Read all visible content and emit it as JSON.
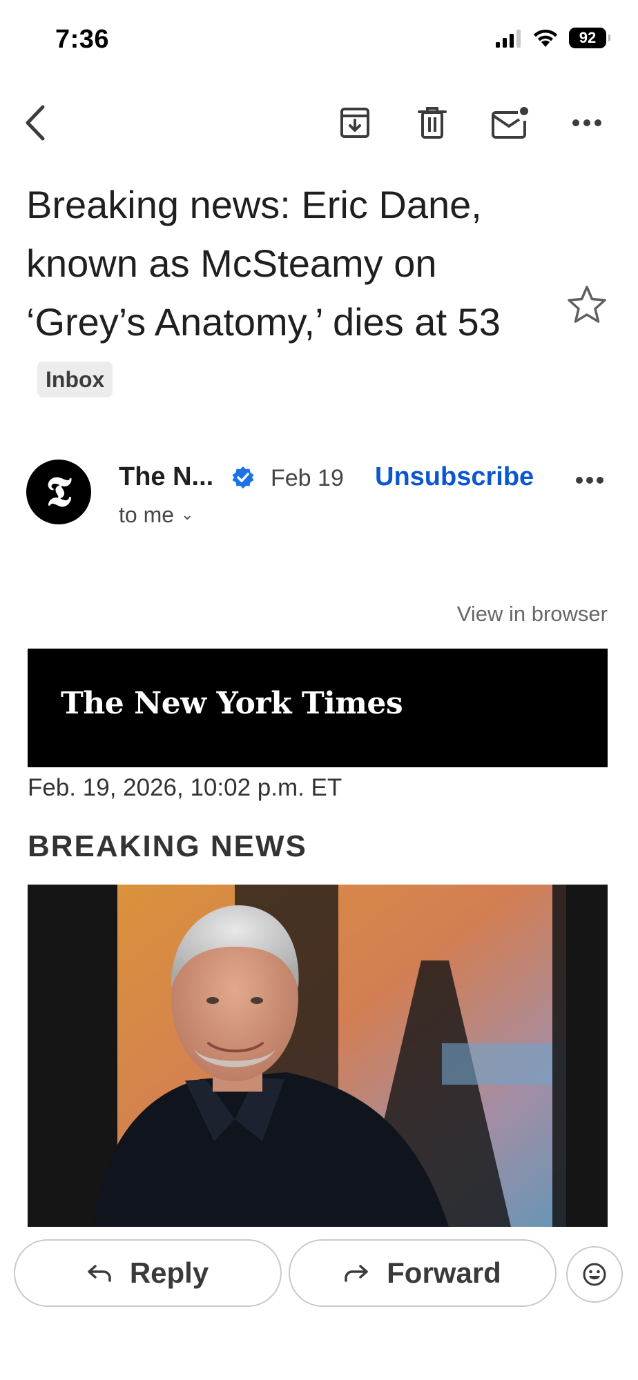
{
  "status_bar": {
    "time": "7:36",
    "battery": "92",
    "icons": [
      "cellular-signal-icon",
      "wifi-icon",
      "battery-icon"
    ]
  },
  "toolbar": {
    "icons": [
      "back-arrow-icon",
      "archive-icon",
      "delete-icon",
      "mark-unread-icon",
      "more-options-icon"
    ]
  },
  "email": {
    "subject": "Breaking news: Eric Dane, known as McSteamy on ‘Grey’s Anatomy,’ dies at 53",
    "label": "Inbox",
    "starred": false,
    "sender": {
      "name": "The N...",
      "verified": true,
      "date": "Feb 19",
      "recipient": "to me",
      "avatar_letter": "𝕿",
      "unsubscribe_label": "Unsubscribe"
    }
  },
  "body": {
    "view_in_browser": "View in browser",
    "masthead": "The New York Times",
    "timestamp": "Feb. 19, 2026, 10:02 p.m. ET",
    "kicker": "BREAKING NEWS"
  },
  "actions": {
    "reply_label": "Reply",
    "forward_label": "Forward",
    "emoji_icon": "emoji-reaction-icon"
  },
  "colors": {
    "accent_blue": "#0b57d0",
    "verified_blue": "#1a73e8",
    "banner_black": "#000000"
  }
}
